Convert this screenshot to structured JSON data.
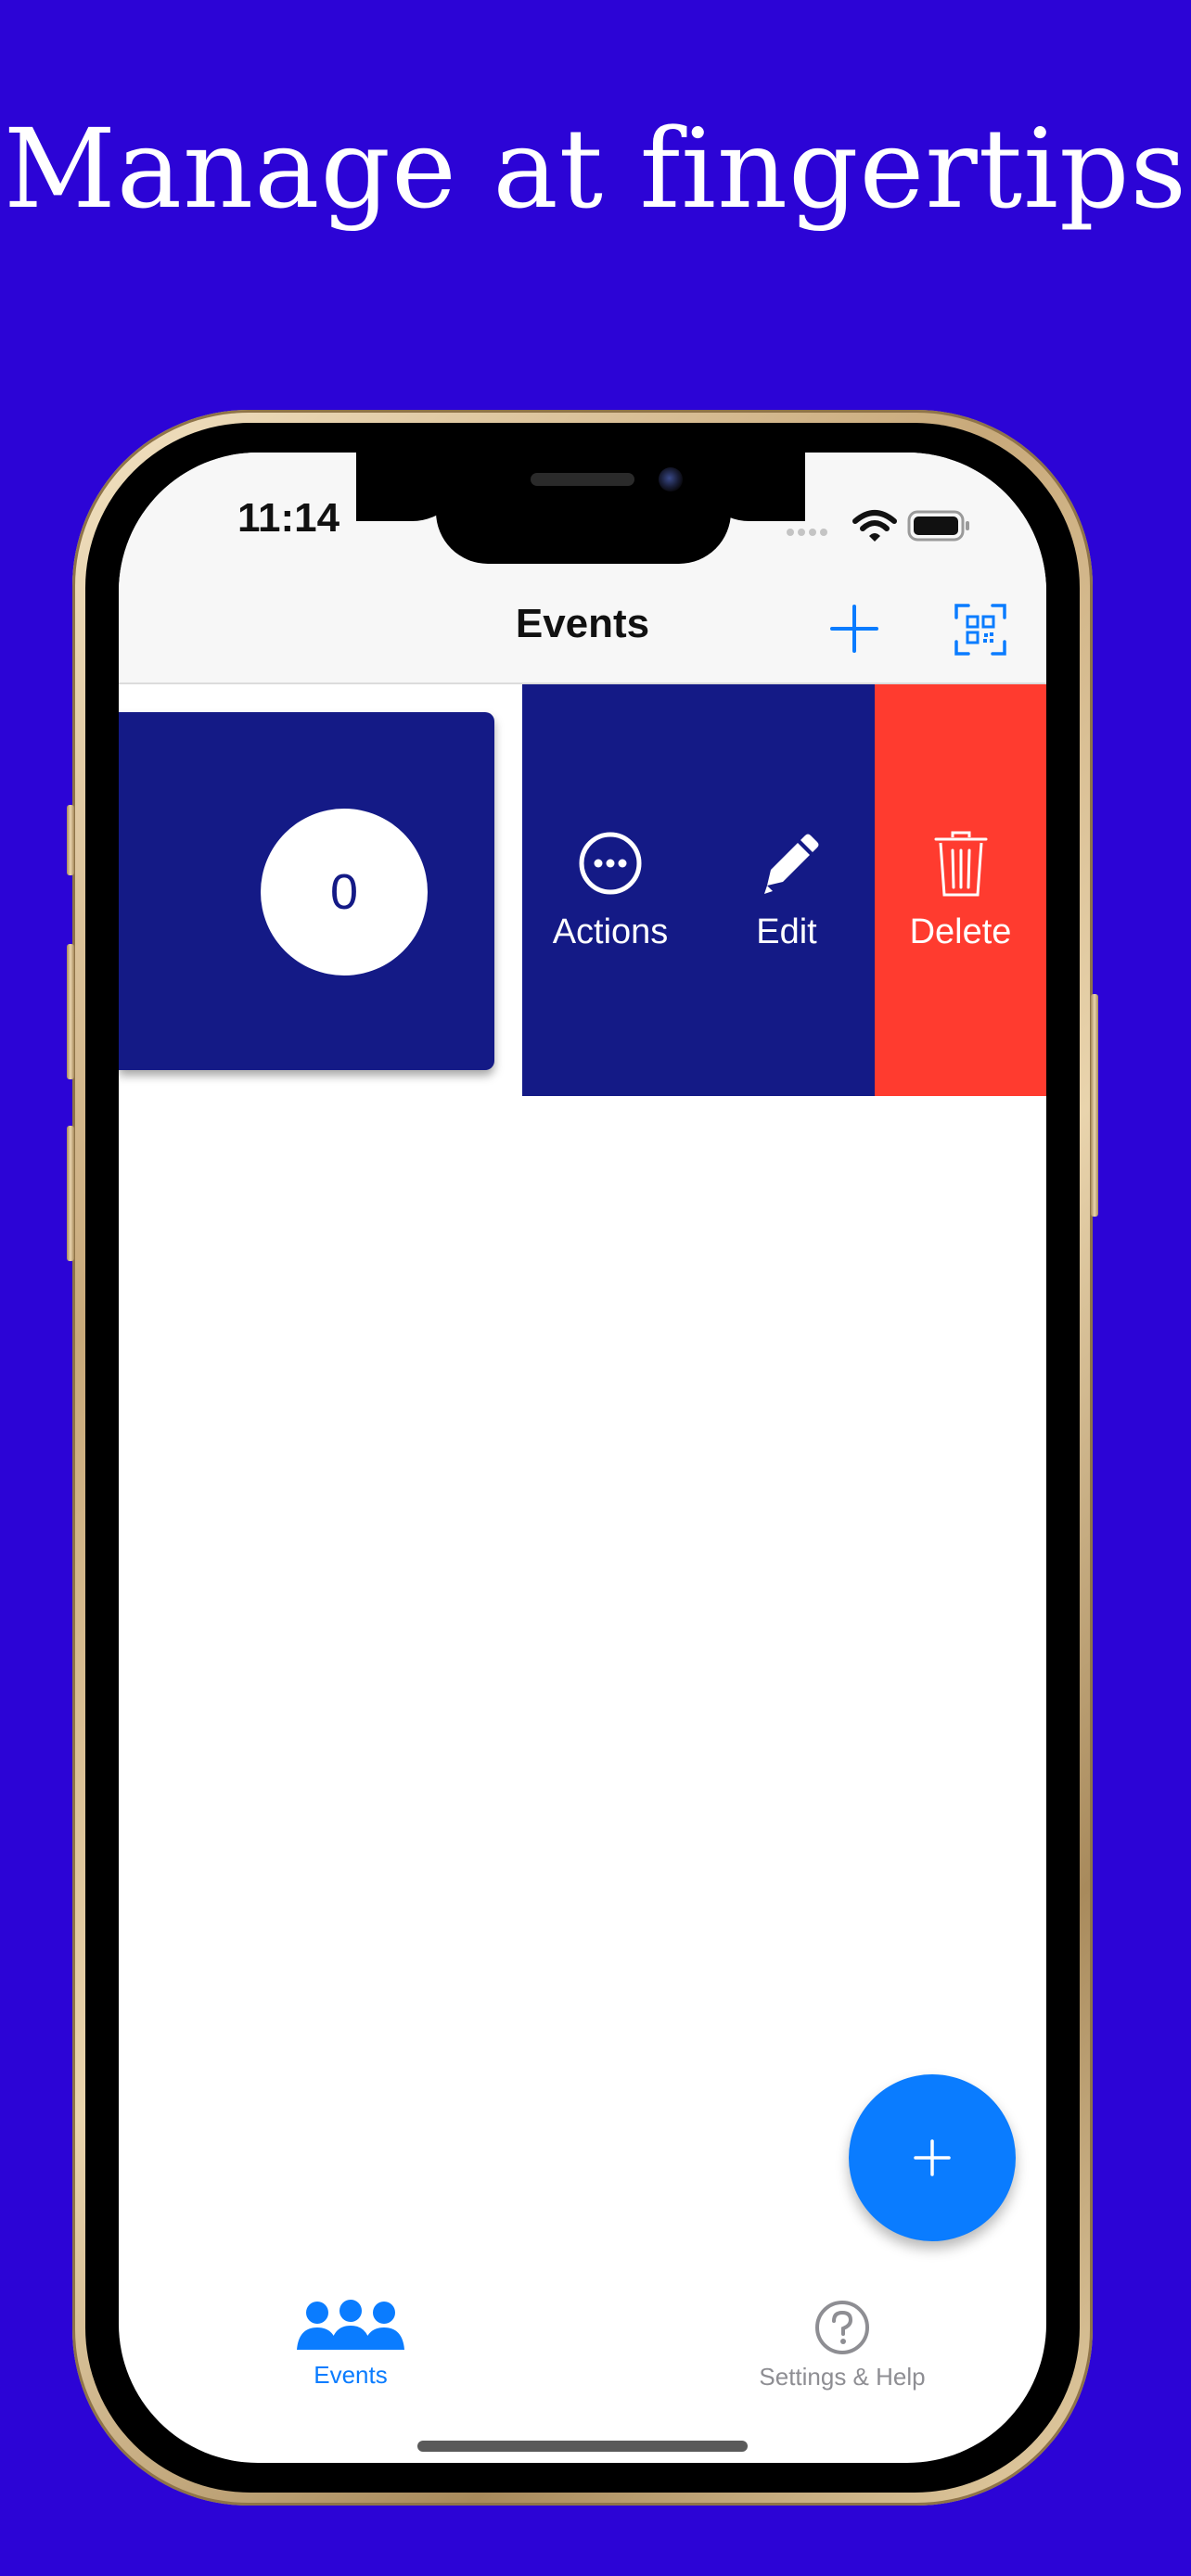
{
  "promo": {
    "headline": "Manage at fingertips"
  },
  "status_bar": {
    "time": "11:14"
  },
  "nav": {
    "title": "Events",
    "add_icon": "plus-icon",
    "scan_icon": "qr-code-icon"
  },
  "event_row": {
    "count": "0",
    "swipe_actions": [
      {
        "label": "Actions",
        "icon": "ellipsis-circle-icon"
      },
      {
        "label": "Edit",
        "icon": "pencil-icon"
      },
      {
        "label": "Delete",
        "icon": "trash-icon"
      }
    ]
  },
  "tab_bar": {
    "tabs": [
      {
        "label": "Events",
        "icon": "people-icon",
        "selected": true
      },
      {
        "label": "Settings & Help",
        "icon": "question-circle-icon",
        "selected": false
      }
    ]
  },
  "colors": {
    "background": "#2c04d6",
    "card": "#141a86",
    "delete": "#ff3b2f",
    "accent": "#0a7cff"
  }
}
